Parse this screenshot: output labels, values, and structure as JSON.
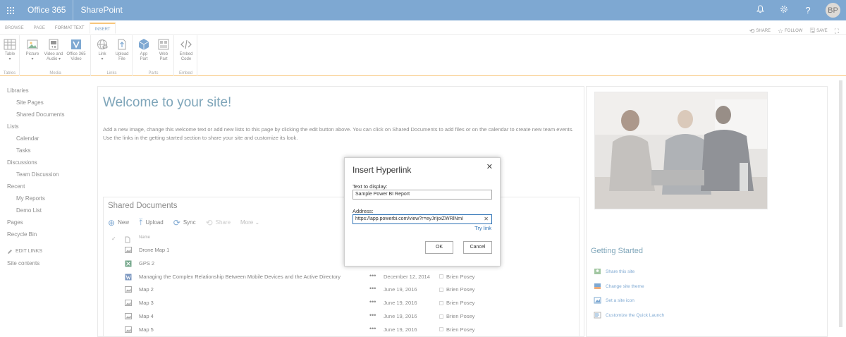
{
  "suite_bar": {
    "app_name": "Office 365",
    "site_name": "SharePoint",
    "avatar_initials": "BP",
    "bar_color": "#2f73b6"
  },
  "ribbon": {
    "tabs": [
      "BROWSE",
      "PAGE",
      "FORMAT TEXT",
      "INSERT"
    ],
    "active_tab": "INSERT",
    "actions": [
      "SHARE",
      "FOLLOW",
      "SAVE"
    ],
    "groups": [
      {
        "label": "Tables",
        "buttons": [
          {
            "label1": "Table",
            "label2": "▾",
            "icon": "table-icon"
          }
        ]
      },
      {
        "label": "Media",
        "buttons": [
          {
            "label1": "Picture",
            "label2": "▾",
            "icon": "picture-icon"
          },
          {
            "label1": "Video and",
            "label2": "Audio ▾",
            "icon": "video-audio-icon"
          },
          {
            "label1": "Office 365",
            "label2": "Video",
            "icon": "office-video-icon"
          }
        ]
      },
      {
        "label": "Links",
        "buttons": [
          {
            "label1": "Link",
            "label2": "▾",
            "icon": "link-icon"
          },
          {
            "label1": "Upload",
            "label2": "File",
            "icon": "upload-file-icon"
          }
        ]
      },
      {
        "label": "Parts",
        "buttons": [
          {
            "label1": "App",
            "label2": "Part",
            "icon": "app-part-icon"
          },
          {
            "label1": "Web",
            "label2": "Part",
            "icon": "web-part-icon"
          }
        ]
      },
      {
        "label": "Embed",
        "buttons": [
          {
            "label1": "Embed",
            "label2": "Code",
            "icon": "embed-code-icon"
          }
        ]
      }
    ]
  },
  "quick_launch": [
    {
      "label": "Libraries",
      "level": 0
    },
    {
      "label": "Site Pages",
      "level": 1
    },
    {
      "label": "Shared Documents",
      "level": 1
    },
    {
      "label": "Lists",
      "level": 0
    },
    {
      "label": "Calendar",
      "level": 1
    },
    {
      "label": "Tasks",
      "level": 1
    },
    {
      "label": "Discussions",
      "level": 0
    },
    {
      "label": "Team Discussion",
      "level": 1
    },
    {
      "label": "Recent",
      "level": 0
    },
    {
      "label": "My Reports",
      "level": 1
    },
    {
      "label": "Demo List",
      "level": 1
    },
    {
      "label": "Pages",
      "level": 0
    },
    {
      "label": "Recycle Bin",
      "level": 0
    }
  ],
  "edit_links": "EDIT LINKS",
  "site_contents": "Site contents",
  "main": {
    "welcome_title": "Welcome to your site!",
    "welcome_text": "Add a new image, change this welcome text or add new lists to this page by clicking the edit button above. You can click on Shared Documents to add files or on the calendar to create new team events. Use the links in the getting started section to share your site and customize its look."
  },
  "shared_documents": {
    "title": "Shared Documents",
    "toolbar": {
      "new": "New",
      "upload": "Upload",
      "sync": "Sync",
      "share": "Share",
      "more": "More"
    },
    "column_name": "Name",
    "rows": [
      {
        "name": "Drone Map 1",
        "type": "image",
        "date": "",
        "author": ""
      },
      {
        "name": "GPS 2",
        "type": "excel",
        "date": "",
        "author": ""
      },
      {
        "name": "Managing the Complex Relationship Between Mobile Devices and the Active Directory",
        "type": "word",
        "date": "December 12, 2014",
        "author": "Brien Posey"
      },
      {
        "name": "Map 2",
        "type": "image",
        "date": "June 19, 2016",
        "author": "Brien Posey"
      },
      {
        "name": "Map 3",
        "type": "image",
        "date": "June 19, 2016",
        "author": "Brien Posey"
      },
      {
        "name": "Map 4",
        "type": "image",
        "date": "June 19, 2016",
        "author": "Brien Posey"
      },
      {
        "name": "Map 5",
        "type": "image",
        "date": "June 19, 2016",
        "author": "Brien Posey"
      }
    ]
  },
  "getting_started": {
    "title": "Getting Started",
    "items": [
      "Share this site",
      "Change site theme",
      "Set a site icon",
      "Customize the Quick Launch"
    ]
  },
  "dialog": {
    "title": "Insert Hyperlink",
    "text_label": "Text to display:",
    "text_value": "Sample Power BI Report",
    "address_label": "Address:",
    "address_value": "https://app.powerbi.com/view?r=eyJrIjoiZWRlNmI",
    "try_link": "Try link",
    "ok": "OK",
    "cancel": "Cancel"
  }
}
